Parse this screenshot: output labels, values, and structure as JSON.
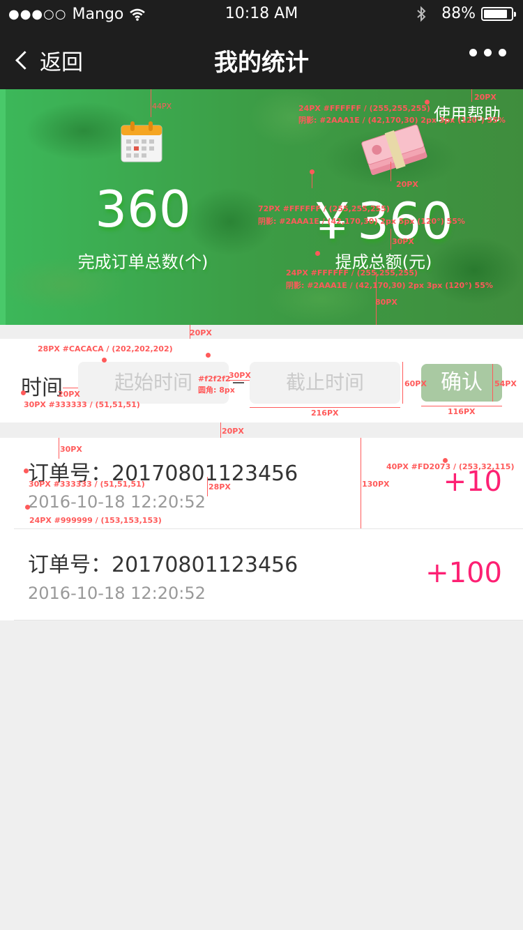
{
  "status_bar": {
    "signal_dots": "●●●○○",
    "carrier": "Mango",
    "time": "10:18 AM",
    "battery": "88%",
    "battery_level": 0.88
  },
  "nav": {
    "back_label": "返回",
    "title": "我的统计"
  },
  "banner": {
    "help_label": "使用帮助",
    "orders_value": "360",
    "orders_label": "完成订单总数(个)",
    "amount_value": "￥360",
    "amount_label": "提成总额(元)"
  },
  "filter": {
    "label": "时间",
    "start_placeholder": "起始时间",
    "end_placeholder": "截止时间",
    "confirm_label": "确认"
  },
  "orders": [
    {
      "title": "订单号：20170801123456",
      "time": "2016-10-18   12:20:52",
      "amount": "+10"
    },
    {
      "title": "订单号：20170801123456",
      "time": "2016-10-18   12:20:52",
      "amount": "+100"
    }
  ],
  "annotations": {
    "banner_top_gap": "44PX",
    "help_gap": "20PX",
    "help_spec": "24PX #FFFFFF / (255,255,255)",
    "help_shadow": "阴影: #2AAA1E / (42,170,30) 2px 3px (120°) 55%",
    "icon_gap": "20PX",
    "value_spec": "72PX #FFFFFF / (255,255,255)",
    "value_shadow": "阴影: #2AAA1E / (42,170,30) 2px 5px (120°) 55%",
    "label_gap": "30PX",
    "label_spec": "24PX #FFFFFF / (255,255,255)",
    "label_shadow": "阴影: #2AAA1E / (42,170,30) 2px 3px (120°) 55%",
    "banner_bottom": "80PX",
    "section_gap_1": "20PX",
    "placeholder_spec": "28PX #CACACA / (202,202,202)",
    "input_bg": "#f2f2f2",
    "radius": "圆角: 8px",
    "input_gap": "30PX",
    "label_input_gap": "20PX",
    "filter_label_spec": "30PX #333333 / (51,51,51)",
    "input_width": "216PX",
    "input_height": "60PX",
    "button_height": "54PX",
    "button_width": "116PX",
    "section_gap_2": "20PX",
    "item_top": "30PX",
    "title_spec": "30PX #333333 / (51,51,51)",
    "line_gap": "28PX",
    "time_spec": "24PX #999999 / (153,153,153)",
    "item_height": "130PX",
    "amount_spec": "40PX #FD2073 / (253,32,115)"
  },
  "colors": {
    "bar_bg": "#1e1e1e",
    "banner_green": "#3c9c45",
    "placeholder": "#cacaca",
    "input_bg": "#f2f2f2",
    "confirm_bg": "#a9c9a2",
    "title_text": "#333333",
    "time_text": "#999999",
    "amount": "#fd2073",
    "annotation": "#ff5a5a"
  }
}
